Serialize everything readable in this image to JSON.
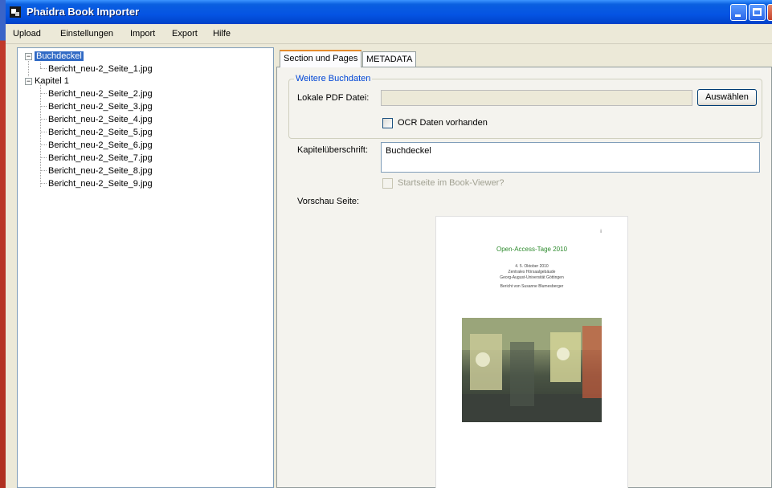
{
  "window": {
    "title": "Phaidra Book Importer"
  },
  "menu": {
    "items": [
      "Upload",
      "Einstellungen",
      "Import",
      "Export",
      "Hilfe"
    ]
  },
  "tree": {
    "nodes": [
      {
        "label": "Buchdeckel",
        "children": [
          "Bericht_neu-2_Seite_1.jpg"
        ]
      },
      {
        "label": "Kapitel 1",
        "children": [
          "Bericht_neu-2_Seite_2.jpg",
          "Bericht_neu-2_Seite_3.jpg",
          "Bericht_neu-2_Seite_4.jpg",
          "Bericht_neu-2_Seite_5.jpg",
          "Bericht_neu-2_Seite_6.jpg",
          "Bericht_neu-2_Seite_7.jpg",
          "Bericht_neu-2_Seite_8.jpg",
          "Bericht_neu-2_Seite_9.jpg"
        ]
      }
    ],
    "selected": "Buchdeckel"
  },
  "tabs": [
    "Section und Pages",
    "METADATA"
  ],
  "active_tab": "Section und Pages",
  "group": {
    "title": "Weitere Buchdaten",
    "pdf_label": "Lokale PDF Datei:",
    "pdf_value": "",
    "choose_button": "Auswählen",
    "ocr_label": "OCR Daten vorhanden",
    "ocr_checked": false
  },
  "chapter": {
    "label": "Kapitelüberschrift:",
    "value": "Buchdeckel"
  },
  "startseite": {
    "label": "Startseite im Book-Viewer?",
    "checked": false,
    "enabled": false
  },
  "preview": {
    "label": "Vorschau Seite:",
    "page_marker": "i",
    "doc_title": "Open-Access-Tage 2010",
    "doc_lines": [
      "4. 5. Oktober 2010",
      "Zentrales Hörsaalgebäude",
      "Georg-August-Universität Göttingen",
      "Bericht von Susanne Blumesberger"
    ]
  },
  "colors": {
    "title_blue": "#0554e3",
    "selection": "#316ac5",
    "group_title": "#0046d5",
    "tab_highlight": "#e68b2c",
    "doc_title_green": "#2e8b2e"
  },
  "icons": {
    "app": "phaidra-app-icon",
    "expand": "minus-box-icon"
  }
}
